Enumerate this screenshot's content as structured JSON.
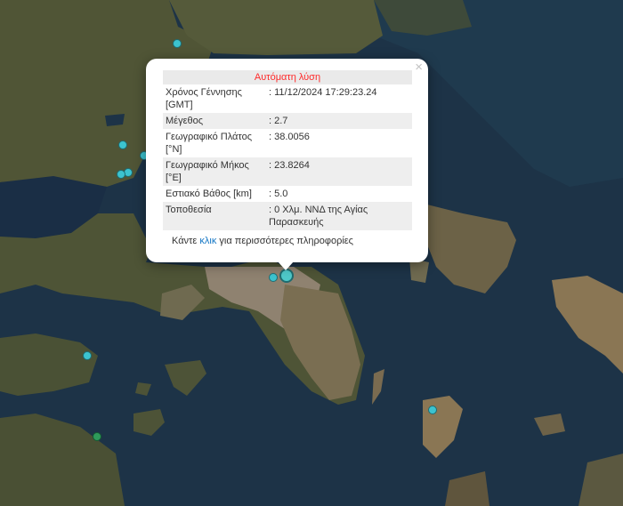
{
  "popup": {
    "title": "Αυτόματη λύση",
    "close_symbol": "×",
    "rows": [
      {
        "label": "Χρόνος Γέννησης [GMT]",
        "value": ": 11/12/2024 17:29:23.24"
      },
      {
        "label": "Μέγεθος",
        "value": ": 2.7"
      },
      {
        "label": "Γεωγραφικό Πλάτος [°N]",
        "value": ": 38.0056"
      },
      {
        "label": "Γεωγραφικό Μήκος [°E]",
        "value": ": 23.8264"
      },
      {
        "label": "Εστιακό Βάθος [km]",
        "value": ": 5.0"
      },
      {
        "label": "Τοποθεσία",
        "value": ": 0 Χλμ. ΝΝΔ της Αγίας Παρασκευής"
      }
    ],
    "more_prefix": "Κάντε ",
    "more_link": "κλικ",
    "more_suffix": " για περισσότερες πληροφορίες"
  },
  "colors": {
    "sea": "#1d3347",
    "land": "#4d5236",
    "urban": "#8f8270",
    "marker_cyan": "#3cc3cf",
    "marker_green": "#2e9a5a",
    "marker_selected": "#4fc9c9",
    "title_red": "#ff2a2a",
    "link_blue": "#1577c5"
  }
}
